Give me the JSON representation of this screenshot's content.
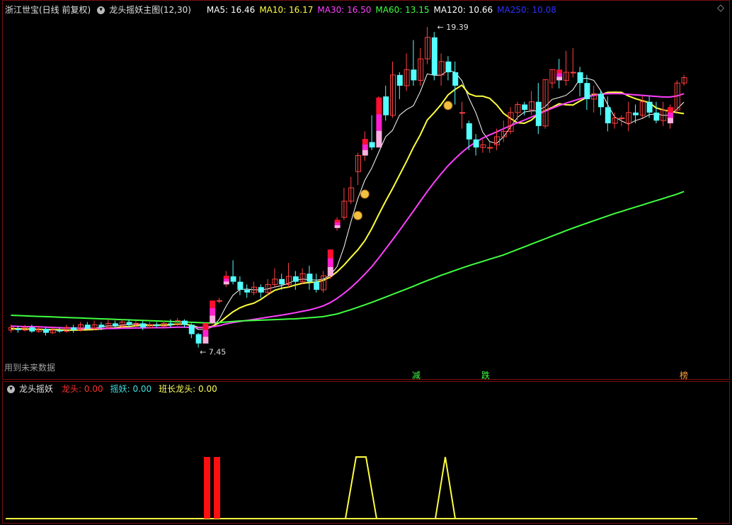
{
  "header": {
    "stock": "浙江世宝(日线 前复权)",
    "indicator": "龙头摇妖主图(12,30)",
    "ma": [
      {
        "label": "MA5: 16.46",
        "color": "#ffffff"
      },
      {
        "label": "MA10: 16.17",
        "color": "#ffff40"
      },
      {
        "label": "MA30: 16.50",
        "color": "#ff40ff"
      },
      {
        "label": "MA60: 13.15",
        "color": "#40ff40"
      },
      {
        "label": "MA120: 10.66",
        "color": "#ffffff"
      },
      {
        "label": "MA250: 10.08",
        "color": "#3030ff"
      }
    ]
  },
  "main_chart": {
    "future_data_note": "用到未来数据",
    "high_label": "19.39",
    "low_label": "7.45",
    "signals": [
      {
        "text": "减",
        "color": "#40ff40"
      },
      {
        "text": "跌",
        "color": "#40ff40"
      },
      {
        "text": "榜",
        "color": "#ffa040"
      }
    ],
    "diamond_icon": "◇"
  },
  "sub_chart": {
    "title": "龙头摇妖",
    "values": [
      {
        "label": "龙头: 0.00",
        "color": "#ff3030"
      },
      {
        "label": "摇妖: 0.00",
        "color": "#40e0e0"
      },
      {
        "label": "班长龙头: 0.00",
        "color": "#ffff60"
      }
    ]
  },
  "chart_data": {
    "type": "candlestick",
    "price_range": [
      7.45,
      19.39
    ],
    "candles": [
      [
        8.1,
        8.2,
        8.3,
        8.0
      ],
      [
        8.15,
        8.1,
        8.25,
        8.0
      ],
      [
        8.1,
        8.2,
        8.3,
        8.05
      ],
      [
        8.2,
        8.05,
        8.3,
        8.0
      ],
      [
        8.05,
        8.15,
        8.25,
        8.0
      ],
      [
        8.15,
        8.0,
        8.2,
        7.9
      ],
      [
        8.0,
        8.1,
        8.2,
        7.95
      ],
      [
        8.1,
        8.05,
        8.2,
        8.0
      ],
      [
        8.05,
        8.2,
        8.3,
        8.0
      ],
      [
        8.2,
        8.1,
        8.3,
        8.0
      ],
      [
        8.1,
        8.3,
        8.4,
        8.05
      ],
      [
        8.3,
        8.15,
        8.4,
        8.1
      ],
      [
        8.15,
        8.3,
        8.45,
        8.1
      ],
      [
        8.3,
        8.2,
        8.4,
        8.1
      ],
      [
        8.2,
        8.35,
        8.5,
        8.15
      ],
      [
        8.35,
        8.25,
        8.45,
        8.2
      ],
      [
        8.25,
        8.4,
        8.5,
        8.2
      ],
      [
        8.4,
        8.3,
        8.5,
        8.2
      ],
      [
        8.3,
        8.35,
        8.45,
        8.2
      ],
      [
        8.35,
        8.2,
        8.45,
        8.1
      ],
      [
        8.2,
        8.3,
        8.4,
        8.15
      ],
      [
        8.3,
        8.25,
        8.4,
        8.2
      ],
      [
        8.25,
        8.35,
        8.45,
        8.2
      ],
      [
        8.35,
        8.3,
        8.5,
        8.2
      ],
      [
        8.3,
        8.45,
        8.55,
        8.25
      ],
      [
        8.45,
        8.3,
        8.5,
        8.2
      ],
      [
        8.3,
        7.95,
        8.35,
        7.8
      ],
      [
        7.95,
        7.6,
        8.0,
        7.45
      ],
      [
        7.6,
        8.36,
        8.36,
        7.6
      ],
      [
        8.36,
        9.2,
        9.2,
        8.3
      ],
      [
        9.2,
        9.2,
        9.3,
        9.1
      ],
      [
        9.8,
        10.12,
        10.3,
        9.7
      ],
      [
        10.1,
        9.9,
        10.7,
        9.8
      ],
      [
        9.9,
        9.6,
        10.1,
        9.4
      ],
      [
        9.6,
        9.5,
        9.8,
        9.3
      ],
      [
        9.5,
        9.7,
        9.9,
        9.4
      ],
      [
        9.7,
        9.5,
        9.8,
        9.3
      ],
      [
        9.5,
        9.8,
        10.0,
        9.4
      ],
      [
        9.8,
        10.0,
        10.4,
        9.7
      ],
      [
        10.0,
        9.8,
        10.2,
        9.6
      ],
      [
        9.8,
        10.1,
        10.6,
        9.7
      ],
      [
        10.1,
        9.9,
        10.3,
        9.6
      ],
      [
        9.9,
        10.2,
        10.4,
        9.8
      ],
      [
        10.2,
        9.9,
        10.5,
        9.6
      ],
      [
        9.9,
        9.6,
        10.2,
        9.5
      ],
      [
        9.6,
        10.12,
        10.3,
        9.5
      ],
      [
        10.12,
        11.1,
        11.1,
        10.0
      ],
      [
        11.9,
        12.21,
        12.3,
        11.8
      ],
      [
        12.3,
        12.9,
        13.4,
        12.2
      ],
      [
        12.9,
        13.4,
        13.8,
        12.8
      ],
      [
        14.0,
        14.6,
        14.7,
        13.5
      ],
      [
        14.6,
        15.22,
        15.5,
        14.4
      ],
      [
        15.1,
        14.9,
        16.1,
        14.8
      ],
      [
        14.9,
        16.76,
        16.8,
        14.9
      ],
      [
        16.8,
        16.1,
        17.2,
        15.9
      ],
      [
        16.1,
        17.6,
        18.1,
        16.0
      ],
      [
        17.6,
        17.2,
        17.7,
        16.7
      ],
      [
        17.2,
        17.8,
        18.4,
        17.0
      ],
      [
        17.8,
        17.4,
        18.9,
        17.2
      ],
      [
        17.4,
        18.2,
        18.6,
        17.2
      ],
      [
        18.2,
        19.0,
        19.39,
        18.0
      ],
      [
        19.0,
        17.6,
        19.2,
        17.4
      ],
      [
        17.6,
        18.1,
        18.4,
        17.2
      ],
      [
        18.1,
        17.7,
        18.3,
        17.4
      ],
      [
        17.7,
        17.2,
        18.1,
        16.5
      ],
      [
        16.2,
        16.2,
        16.6,
        15.6
      ],
      [
        15.8,
        15.2,
        15.9,
        14.8
      ],
      [
        15.2,
        14.9,
        15.4,
        14.6
      ],
      [
        14.9,
        15.0,
        15.2,
        14.7
      ],
      [
        14.9,
        14.9,
        15.1,
        14.7
      ],
      [
        15.0,
        15.3,
        15.6,
        14.8
      ],
      [
        15.3,
        15.5,
        15.9,
        15.1
      ],
      [
        15.5,
        16.2,
        16.4,
        15.4
      ],
      [
        16.2,
        16.5,
        16.6,
        15.9
      ],
      [
        16.5,
        16.3,
        16.6,
        16.1
      ],
      [
        16.3,
        16.6,
        17.0,
        16.1
      ],
      [
        16.6,
        15.7,
        17.3,
        15.4
      ],
      [
        15.7,
        17.43,
        17.43,
        15.6
      ],
      [
        17.3,
        17.8,
        17.8,
        17.1
      ],
      [
        17.8,
        17.4,
        18.2,
        17.1
      ],
      [
        17.4,
        17.7,
        18.5,
        17.2
      ],
      [
        17.7,
        17.7,
        18.6,
        17.5
      ],
      [
        17.7,
        17.3,
        17.9,
        16.8
      ],
      [
        17.3,
        16.7,
        17.6,
        16.3
      ],
      [
        16.7,
        16.9,
        17.2,
        16.2
      ],
      [
        16.9,
        16.4,
        17.0,
        16.1
      ],
      [
        16.4,
        15.8,
        16.8,
        15.5
      ],
      [
        15.8,
        16.0,
        16.2,
        15.6
      ],
      [
        16.0,
        16.0,
        16.1,
        15.7
      ],
      [
        15.8,
        16.2,
        16.6,
        15.5
      ],
      [
        16.2,
        16.1,
        16.5,
        15.8
      ],
      [
        16.1,
        16.6,
        16.8,
        16.0
      ],
      [
        16.6,
        16.2,
        16.8,
        16.0
      ],
      [
        16.2,
        15.9,
        16.6,
        15.8
      ],
      [
        15.9,
        16.3,
        16.6,
        15.7
      ],
      [
        15.8,
        16.4,
        16.5,
        15.6
      ],
      [
        16.3,
        17.3,
        17.4,
        16.2
      ],
      [
        17.3,
        17.5,
        17.6,
        17.2
      ]
    ],
    "ma_series": [
      {
        "name": "MA5",
        "color": "#ffffff",
        "values": [
          8.15,
          8.14,
          8.13,
          8.13,
          8.12,
          8.1,
          8.1,
          8.09,
          8.08,
          8.09,
          8.12,
          8.15,
          8.17,
          8.21,
          8.26,
          8.25,
          8.29,
          8.3,
          8.32,
          8.32,
          8.3,
          8.28,
          8.27,
          8.28,
          8.33,
          8.33,
          8.27,
          8.12,
          8.13,
          8.21,
          8.49,
          8.98,
          9.4,
          9.61,
          9.63,
          9.6,
          9.6,
          9.63,
          9.7,
          9.76,
          9.84,
          9.96,
          10.0,
          9.98,
          9.96,
          10.0,
          10.14,
          10.46,
          11.19,
          12.13,
          13.0,
          13.68,
          14.13,
          14.72,
          15.3,
          15.54,
          16.1,
          16.31,
          16.45,
          16.98,
          17.64,
          17.59,
          17.59,
          17.78,
          17.7,
          17.39,
          16.74,
          16.2,
          15.47,
          15.12,
          15.05,
          15.3,
          15.66,
          16.02,
          16.22,
          16.26,
          16.27,
          16.42,
          16.69,
          16.76,
          16.84,
          17.05,
          17.45,
          17.48,
          17.4,
          17.02,
          16.5,
          16.04,
          15.89,
          15.77,
          15.9,
          15.98,
          16.12,
          16.15,
          16.1,
          16.1,
          16.33,
          16.59
        ]
      },
      {
        "name": "MA10",
        "color": "#ffff40",
        "values": [
          8.15,
          8.15,
          8.14,
          8.14,
          8.13,
          8.12,
          8.12,
          8.11,
          8.1,
          8.1,
          8.1,
          8.11,
          8.12,
          8.14,
          8.17,
          8.18,
          8.22,
          8.23,
          8.26,
          8.27,
          8.28,
          8.29,
          8.29,
          8.3,
          8.32,
          8.32,
          8.28,
          8.2,
          8.2,
          8.24,
          8.37,
          8.58,
          8.78,
          8.93,
          9.03,
          9.1,
          9.24,
          9.42,
          9.58,
          9.66,
          9.7,
          9.78,
          9.84,
          9.87,
          9.89,
          9.95,
          10.07,
          10.27,
          10.52,
          10.81,
          11.09,
          11.43,
          11.88,
          12.4,
          12.9,
          13.37,
          13.87,
          14.37,
          14.9,
          15.37,
          15.92,
          16.2,
          16.5,
          16.86,
          17.06,
          17.22,
          16.9,
          16.81,
          16.81,
          16.73,
          16.49,
          16.17,
          15.98,
          15.82,
          15.8,
          15.92,
          16.14,
          16.27,
          16.39,
          16.53,
          16.49,
          16.48,
          16.63,
          16.76,
          16.88,
          16.86,
          16.95,
          16.96,
          16.95,
          16.82,
          16.72,
          16.64,
          16.57,
          16.37,
          16.3,
          16.25,
          16.2,
          16.16
        ]
      },
      {
        "name": "MA30",
        "color": "#ff40ff",
        "values": [
          8.25,
          8.24,
          8.23,
          8.23,
          8.22,
          8.21,
          8.2,
          8.19,
          8.18,
          8.18,
          8.17,
          8.17,
          8.16,
          8.16,
          8.16,
          8.16,
          8.17,
          8.17,
          8.18,
          8.18,
          8.19,
          8.19,
          8.19,
          8.2,
          8.21,
          8.21,
          8.2,
          8.19,
          8.2,
          8.22,
          8.26,
          8.33,
          8.38,
          8.42,
          8.46,
          8.5,
          8.54,
          8.58,
          8.62,
          8.66,
          8.7,
          8.75,
          8.8,
          8.85,
          8.92,
          9.0,
          9.12,
          9.28,
          9.47,
          9.68,
          9.92,
          10.18,
          10.46,
          10.78,
          11.12,
          11.46,
          11.81,
          12.17,
          12.53,
          12.9,
          13.26,
          13.6,
          13.92,
          14.22,
          14.48,
          14.72,
          14.93,
          15.1,
          15.25,
          15.37,
          15.48,
          15.6,
          15.71,
          15.82,
          15.92,
          16.03,
          16.14,
          16.25,
          16.36,
          16.46,
          16.55,
          16.63,
          16.71,
          16.78,
          16.84,
          16.88,
          16.9,
          16.91,
          16.9,
          16.88,
          16.86,
          16.84,
          16.82,
          16.8,
          16.78,
          16.78,
          16.82,
          16.9
        ]
      },
      {
        "name": "MA60",
        "color": "#40ff40",
        "values": [
          8.65,
          8.64,
          8.63,
          8.62,
          8.61,
          8.6,
          8.59,
          8.58,
          8.57,
          8.56,
          8.55,
          8.54,
          8.53,
          8.52,
          8.51,
          8.5,
          8.49,
          8.48,
          8.47,
          8.46,
          8.45,
          8.44,
          8.43,
          8.42,
          8.41,
          8.4,
          8.39,
          8.38,
          8.37,
          8.37,
          8.38,
          8.4,
          8.42,
          8.44,
          8.45,
          8.46,
          8.47,
          8.48,
          8.49,
          8.5,
          8.51,
          8.52,
          8.54,
          8.56,
          8.58,
          8.6,
          8.65,
          8.7,
          8.78,
          8.86,
          8.95,
          9.04,
          9.13,
          9.23,
          9.33,
          9.43,
          9.53,
          9.63,
          9.73,
          9.84,
          9.94,
          10.04,
          10.14,
          10.23,
          10.32,
          10.41,
          10.5,
          10.58,
          10.66,
          10.74,
          10.82,
          10.9,
          11.0,
          11.1,
          11.2,
          11.3,
          11.4,
          11.5,
          11.6,
          11.7,
          11.8,
          11.9,
          11.99,
          12.08,
          12.17,
          12.26,
          12.35,
          12.44,
          12.52,
          12.6,
          12.68,
          12.76,
          12.84,
          12.92,
          13.0,
          13.08,
          13.16,
          13.26
        ]
      }
    ],
    "sub_series": {
      "dragon_bars": [
        29,
        30
      ],
      "yellow_line": "spikes at candles 49-51 and 62"
    }
  }
}
